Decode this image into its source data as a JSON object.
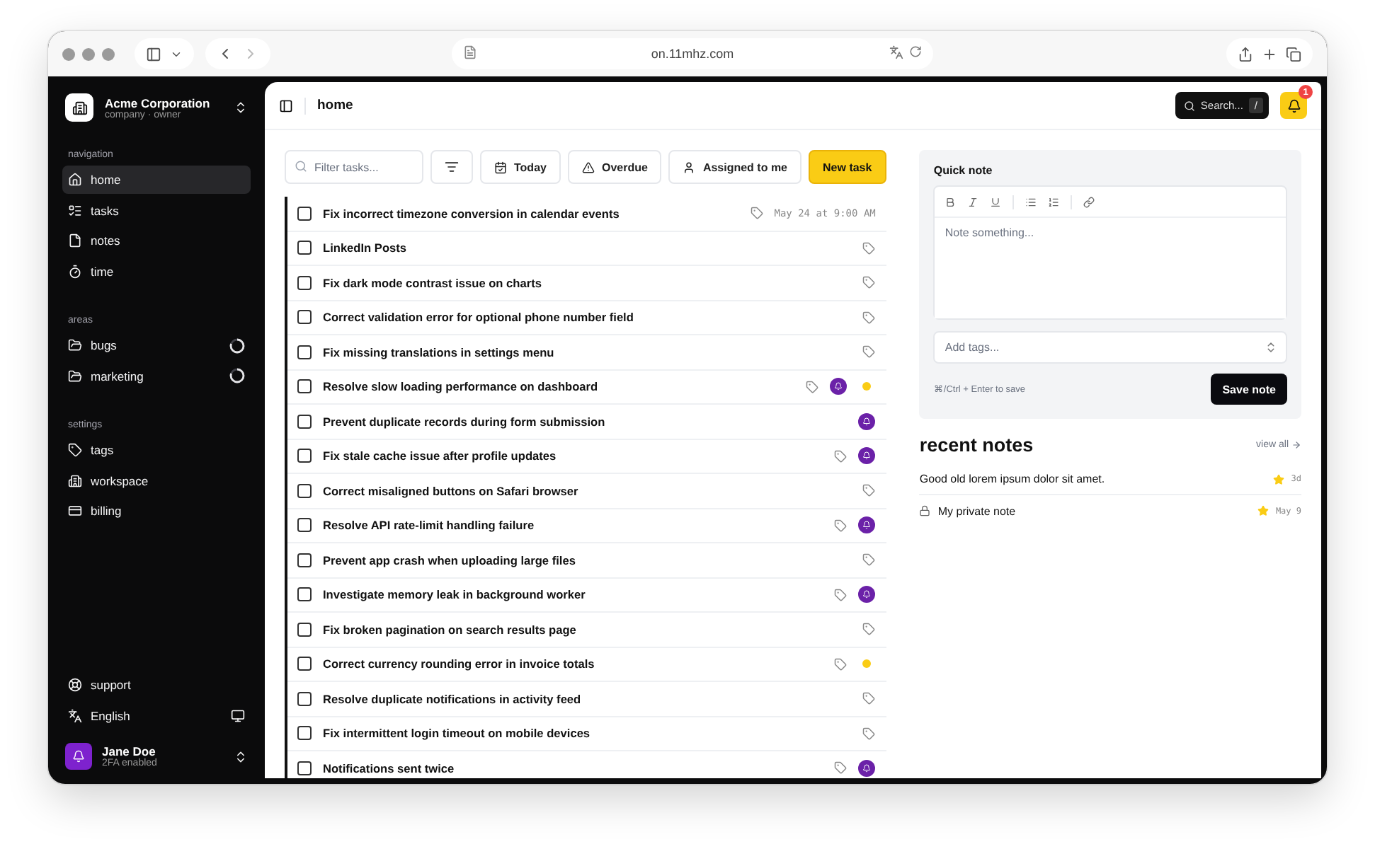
{
  "browser": {
    "url": "on.11mhz.com"
  },
  "sidebar": {
    "org": {
      "name": "Acme Corporation",
      "subtitle": "company · owner"
    },
    "sections": [
      {
        "title": "navigation",
        "items": [
          {
            "label": "home",
            "selected": true
          },
          {
            "label": "tasks",
            "selected": false
          },
          {
            "label": "notes",
            "selected": false
          },
          {
            "label": "time",
            "selected": false
          }
        ]
      },
      {
        "title": "areas",
        "items": [
          {
            "label": "bugs",
            "selected": false,
            "kind": "area"
          },
          {
            "label": "marketing",
            "selected": false,
            "kind": "area"
          }
        ]
      },
      {
        "title": "settings",
        "items": [
          {
            "label": "tags",
            "selected": false
          },
          {
            "label": "workspace",
            "selected": false
          },
          {
            "label": "billing",
            "selected": false
          }
        ]
      }
    ],
    "support": "support",
    "language": "English",
    "user": {
      "name": "Jane Doe",
      "status": "2FA enabled"
    }
  },
  "header": {
    "title": "home",
    "search": {
      "label": "Search...",
      "shortcut": "/"
    },
    "notifications": "1"
  },
  "toolbar": {
    "filter_placeholder": "Filter tasks...",
    "buttons": [
      "Today",
      "Overdue",
      "Assigned to me"
    ],
    "new_task": "New task"
  },
  "tasks": [
    {
      "title": "Fix incorrect timezone conversion in calendar events",
      "checked": false,
      "tagged": true,
      "assigned": false,
      "date": "May 24 at 9:00 AM"
    },
    {
      "title": "LinkedIn Posts",
      "checked": false,
      "tagged": true,
      "assigned": false
    },
    {
      "title": "Fix dark mode contrast issue on charts",
      "checked": false,
      "tagged": true,
      "assigned": false
    },
    {
      "title": "Correct validation error for optional phone number field",
      "checked": false,
      "tagged": true,
      "assigned": false
    },
    {
      "title": "Fix missing translations in settings menu",
      "checked": false,
      "tagged": true,
      "assigned": false
    },
    {
      "title": "Resolve slow loading performance on dashboard",
      "checked": false,
      "tagged": true,
      "assigned": true,
      "color": "#facc15"
    },
    {
      "title": "Prevent duplicate records during form submission",
      "checked": false,
      "tagged": false,
      "assigned": true
    },
    {
      "title": "Fix stale cache issue after profile updates",
      "checked": false,
      "tagged": true,
      "assigned": true
    },
    {
      "title": "Correct misaligned buttons on Safari browser",
      "checked": false,
      "tagged": true,
      "assigned": false
    },
    {
      "title": "Resolve API rate-limit handling failure",
      "checked": false,
      "tagged": true,
      "assigned": true
    },
    {
      "title": "Prevent app crash when uploading large files",
      "checked": false,
      "tagged": true,
      "assigned": false
    },
    {
      "title": "Investigate memory leak in background worker",
      "checked": false,
      "tagged": true,
      "assigned": true
    },
    {
      "title": "Fix broken pagination on search results page",
      "checked": false,
      "tagged": true,
      "assigned": false
    },
    {
      "title": "Correct currency rounding error in invoice totals",
      "checked": false,
      "tagged": true,
      "assigned": false,
      "color": "#facc15"
    },
    {
      "title": "Resolve duplicate notifications in activity feed",
      "checked": false,
      "tagged": true,
      "assigned": false
    },
    {
      "title": "Fix intermittent login timeout on mobile devices",
      "checked": false,
      "tagged": true,
      "assigned": false
    },
    {
      "title": "Notifications sent twice",
      "checked": false,
      "tagged": true,
      "assigned": true
    }
  ],
  "quick_note": {
    "title": "Quick note",
    "placeholder": "Note something...",
    "tags_placeholder": "Add tags...",
    "hint": "⌘/Ctrl + Enter to save",
    "save": "Save note"
  },
  "recent_notes": {
    "title": "recent notes",
    "view_all": "view all",
    "items": [
      {
        "text": "Good old lorem ipsum dolor sit amet.",
        "private": false,
        "starred": true,
        "time": "3d"
      },
      {
        "text": "My private note",
        "private": true,
        "starred": true,
        "time": "May 9"
      }
    ]
  }
}
